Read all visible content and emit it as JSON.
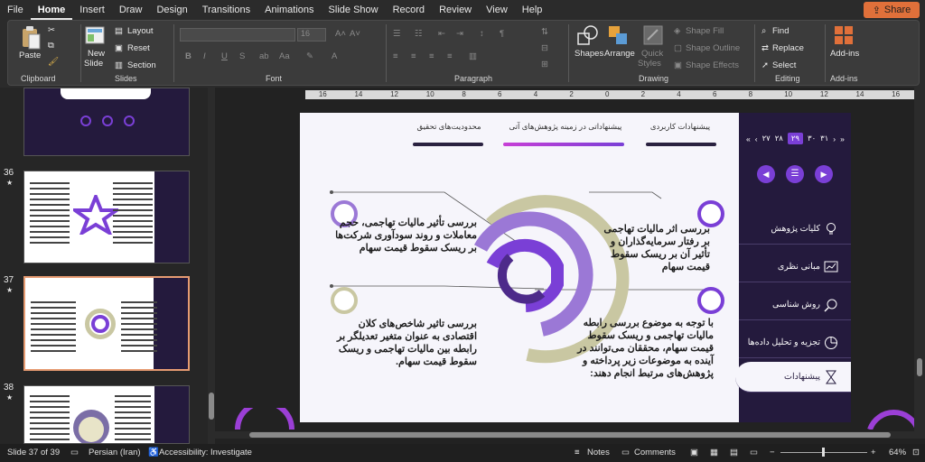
{
  "menu": {
    "items": [
      "File",
      "Home",
      "Insert",
      "Draw",
      "Design",
      "Transitions",
      "Animations",
      "Slide Show",
      "Record",
      "Review",
      "View",
      "Help"
    ],
    "active": "Home",
    "share_label": "Share"
  },
  "ribbon": {
    "clipboard": {
      "paste": "Paste",
      "label": "Clipboard"
    },
    "slides": {
      "new_slide_line1": "New",
      "new_slide_line2": "Slide",
      "layout": "Layout",
      "reset": "Reset",
      "section": "Section",
      "label": "Slides"
    },
    "font": {
      "label": "Font",
      "bold": "B",
      "italic": "I",
      "underline": "U",
      "strike": "S",
      "font_size": "16"
    },
    "paragraph": {
      "label": "Paragraph"
    },
    "drawing": {
      "shapes": "Shapes",
      "arrange": "Arrange",
      "quick_styles_line1": "Quick",
      "quick_styles_line2": "Styles",
      "shape_fill": "Shape Fill",
      "shape_outline": "Shape Outline",
      "shape_effects": "Shape Effects",
      "label": "Drawing"
    },
    "editing": {
      "find": "Find",
      "replace": "Replace",
      "select": "Select",
      "label": "Editing"
    },
    "addins": {
      "addins": "Add-ins",
      "label": "Add-ins"
    }
  },
  "thumbnails": [
    {
      "number": "36",
      "star": "★"
    },
    {
      "number": "37",
      "star": "★"
    },
    {
      "number": "38",
      "star": "★"
    }
  ],
  "ruler": {
    "labels": [
      "16",
      "14",
      "12",
      "10",
      "8",
      "6",
      "4",
      "2",
      "0",
      "2",
      "4",
      "6",
      "8",
      "10",
      "12",
      "14",
      "16"
    ]
  },
  "slide": {
    "tabs": [
      {
        "label": "پیشنهادات کاربردی"
      },
      {
        "label": "پیشنهاداتی در زمینه پژوهش‌های آتی"
      },
      {
        "label": "محدودیت‌های تحقیق"
      }
    ],
    "tab_colors": [
      "#2a2140",
      "#7a3fd6",
      "#2a2140"
    ],
    "pager": {
      "first": "«",
      "prev": "‹",
      "pages": [
        "۳۱",
        "۳۰",
        "۲۹",
        "۲۸",
        "۲۷"
      ],
      "current": "۲۹",
      "next": "›",
      "last": "»"
    },
    "nav": [
      {
        "label": "کلیات پژوهش",
        "icon": "bulb-icon"
      },
      {
        "label": "مبانی نظری",
        "icon": "chart-icon"
      },
      {
        "label": "روش شناسی",
        "icon": "search-icon"
      },
      {
        "label": "تجزیه و تحلیل داده‌ها",
        "icon": "pie-icon"
      },
      {
        "label": "پیشنهادات",
        "icon": "hourglass-icon"
      }
    ],
    "text_top_left": "بررسی تأثیر مالیات تهاجمی، حجم معاملات و روند سودآوری شرکت‌ها بر ریسک سقوط قیمت سهام",
    "text_bottom_left": "بررسی تاثیر شاخص‌های کلان اقتصادی به عنوان متغیر تعدیلگر بر رابطه بین مالیات تهاجمی و ریسک سقوط قیمت سهام.",
    "text_top_right": "بررسی اثر مالیات تهاجمی بر رفتار سرمایه‌گذاران و تأثیر آن بر ریسک سقوط قیمت سهام",
    "text_bottom_right": "با توجه به موضوع بررسی رابطه مالیات تهاجمی و ریسک سقوط قیمت سهام، محققان می‌توانند در آینده به موضوعات زیر پرداخته و پژوهش‌های مرتبط انجام دهند:",
    "colors": {
      "dark": "#241a3d",
      "purple": "#7a3fd6",
      "light_purple": "#9b78d6",
      "khaki": "#c9c7a2",
      "bg": "#f6f5fb"
    }
  },
  "status": {
    "slide_info": "Slide 37 of 39",
    "language": "Persian (Iran)",
    "accessibility": "Accessibility: Investigate",
    "notes": "Notes",
    "comments": "Comments",
    "zoom": "64%"
  }
}
